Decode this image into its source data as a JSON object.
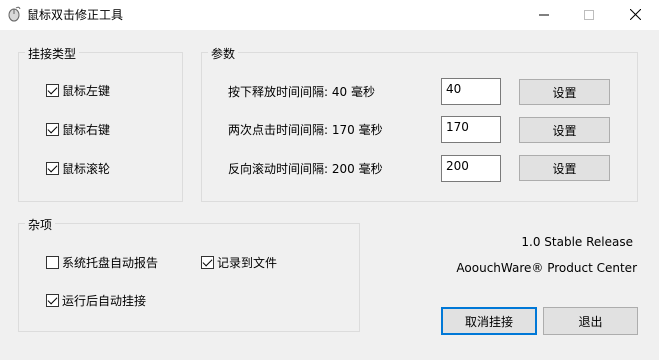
{
  "window": {
    "title": "鼠标双击修正工具",
    "controls": {
      "minimize_icon": "minimize-icon",
      "maximize_icon": "maximize-icon",
      "close_icon": "close-icon"
    }
  },
  "hook_type": {
    "legend": "挂接类型",
    "options": [
      {
        "label": "鼠标左键",
        "checked": true
      },
      {
        "label": "鼠标右键",
        "checked": true
      },
      {
        "label": "鼠标滚轮",
        "checked": true
      }
    ]
  },
  "params": {
    "legend": "参数",
    "rows": [
      {
        "label": "按下释放时间间隔: 40 毫秒",
        "value": "40",
        "button": "设置"
      },
      {
        "label": "两次点击时间间隔: 170 毫秒",
        "value": "170",
        "button": "设置"
      },
      {
        "label": "反向滚动时间间隔: 200 毫秒",
        "value": "200",
        "button": "设置"
      }
    ]
  },
  "misc": {
    "legend": "杂项",
    "options": [
      {
        "label": "系统托盘自动报告",
        "checked": false
      },
      {
        "label": "记录到文件",
        "checked": true
      },
      {
        "label": "运行后自动挂接",
        "checked": true
      }
    ]
  },
  "info": {
    "version": "1.0 Stable Release",
    "company": "AoouchWare® Product Center"
  },
  "actions": {
    "unhook": "取消挂接",
    "exit": "退出"
  },
  "colors": {
    "background": "#f0f0f0",
    "titlebar": "#ffffff",
    "accent": "#0078d7"
  }
}
